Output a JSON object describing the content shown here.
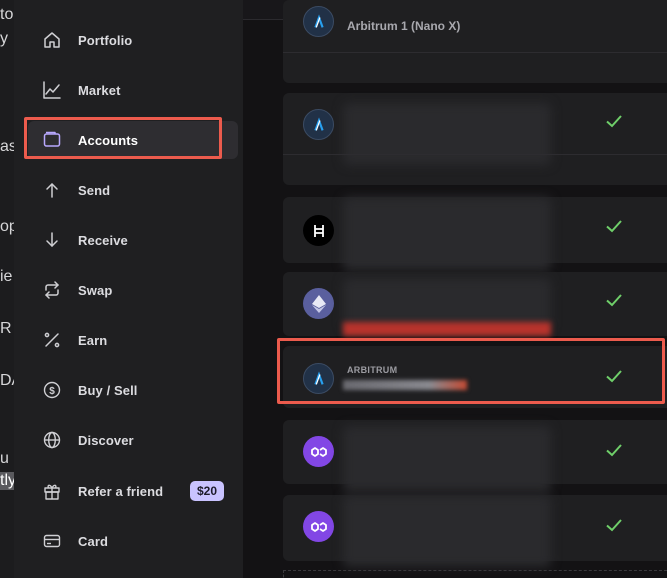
{
  "left_strip": {
    "fragments": [
      "to",
      "y",
      "as",
      "op",
      "ie",
      "R",
      "DA",
      "u",
      "tly"
    ]
  },
  "sidebar": {
    "items": [
      {
        "label": "Portfolio",
        "icon": "home-icon"
      },
      {
        "label": "Market",
        "icon": "chart-line-icon"
      },
      {
        "label": "Accounts",
        "icon": "wallet-icon",
        "active": true
      },
      {
        "label": "Send",
        "icon": "arrow-up-icon"
      },
      {
        "label": "Receive",
        "icon": "arrow-down-icon"
      },
      {
        "label": "Swap",
        "icon": "swap-icon"
      },
      {
        "label": "Earn",
        "icon": "percent-icon"
      },
      {
        "label": "Buy / Sell",
        "icon": "dollar-circle-icon"
      },
      {
        "label": "Discover",
        "icon": "globe-icon"
      },
      {
        "label": "Refer a friend",
        "icon": "gift-icon",
        "badge": "$20"
      },
      {
        "label": "Card",
        "icon": "card-icon"
      }
    ]
  },
  "accounts": {
    "top_account_name": "Arbitrum 1 (Nano X)",
    "highlighted_currency": "ARBITRUM",
    "rows": [
      {
        "coin": "arbitrum-icon",
        "status": "check-icon"
      },
      {
        "coin": "hedera-icon",
        "status": "check-icon"
      },
      {
        "coin": "ethereum-icon",
        "status": "check-icon"
      },
      {
        "coin": "arbitrum-icon",
        "status": "check-icon"
      },
      {
        "coin": "polygon-icon",
        "status": "check-icon"
      },
      {
        "coin": "polygon-icon",
        "status": "check-icon"
      }
    ]
  },
  "colors": {
    "accent_check": "#6fcf6a",
    "annotation": "#ec5b4d",
    "badge_bg": "#c9c3ff",
    "arbitrum": "#28a0f0",
    "polygon": "#8247e5"
  }
}
